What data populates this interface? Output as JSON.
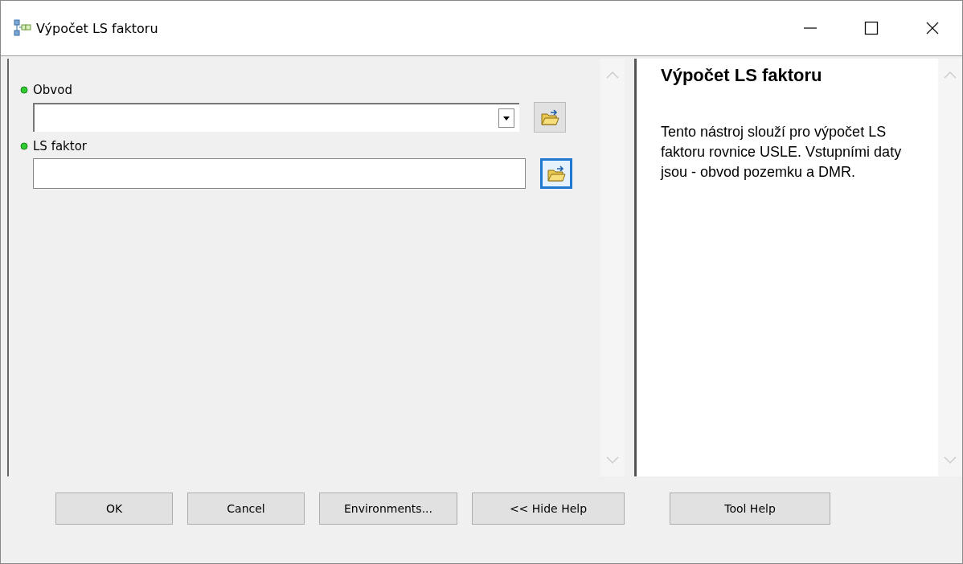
{
  "window": {
    "title": "Výpočet LS faktoru"
  },
  "parameters": [
    {
      "label": "Obvod",
      "kind": "dropdown",
      "browse_focused": false
    },
    {
      "label": "LS faktor",
      "kind": "text",
      "browse_focused": true
    }
  ],
  "help": {
    "title": "Výpočet LS faktoru",
    "text": "Tento nástroj slouží pro výpočet LS faktoru rovnice USLE. Vstupními daty jsou - obvod pozemku a DMR."
  },
  "buttons": [
    {
      "label": "OK",
      "kind": "main"
    },
    {
      "label": "Cancel",
      "kind": "main"
    },
    {
      "label": "Environments...",
      "kind": "main"
    },
    {
      "label": "<< Hide Help",
      "kind": "main"
    },
    {
      "label": "Tool Help",
      "kind": "help"
    }
  ]
}
